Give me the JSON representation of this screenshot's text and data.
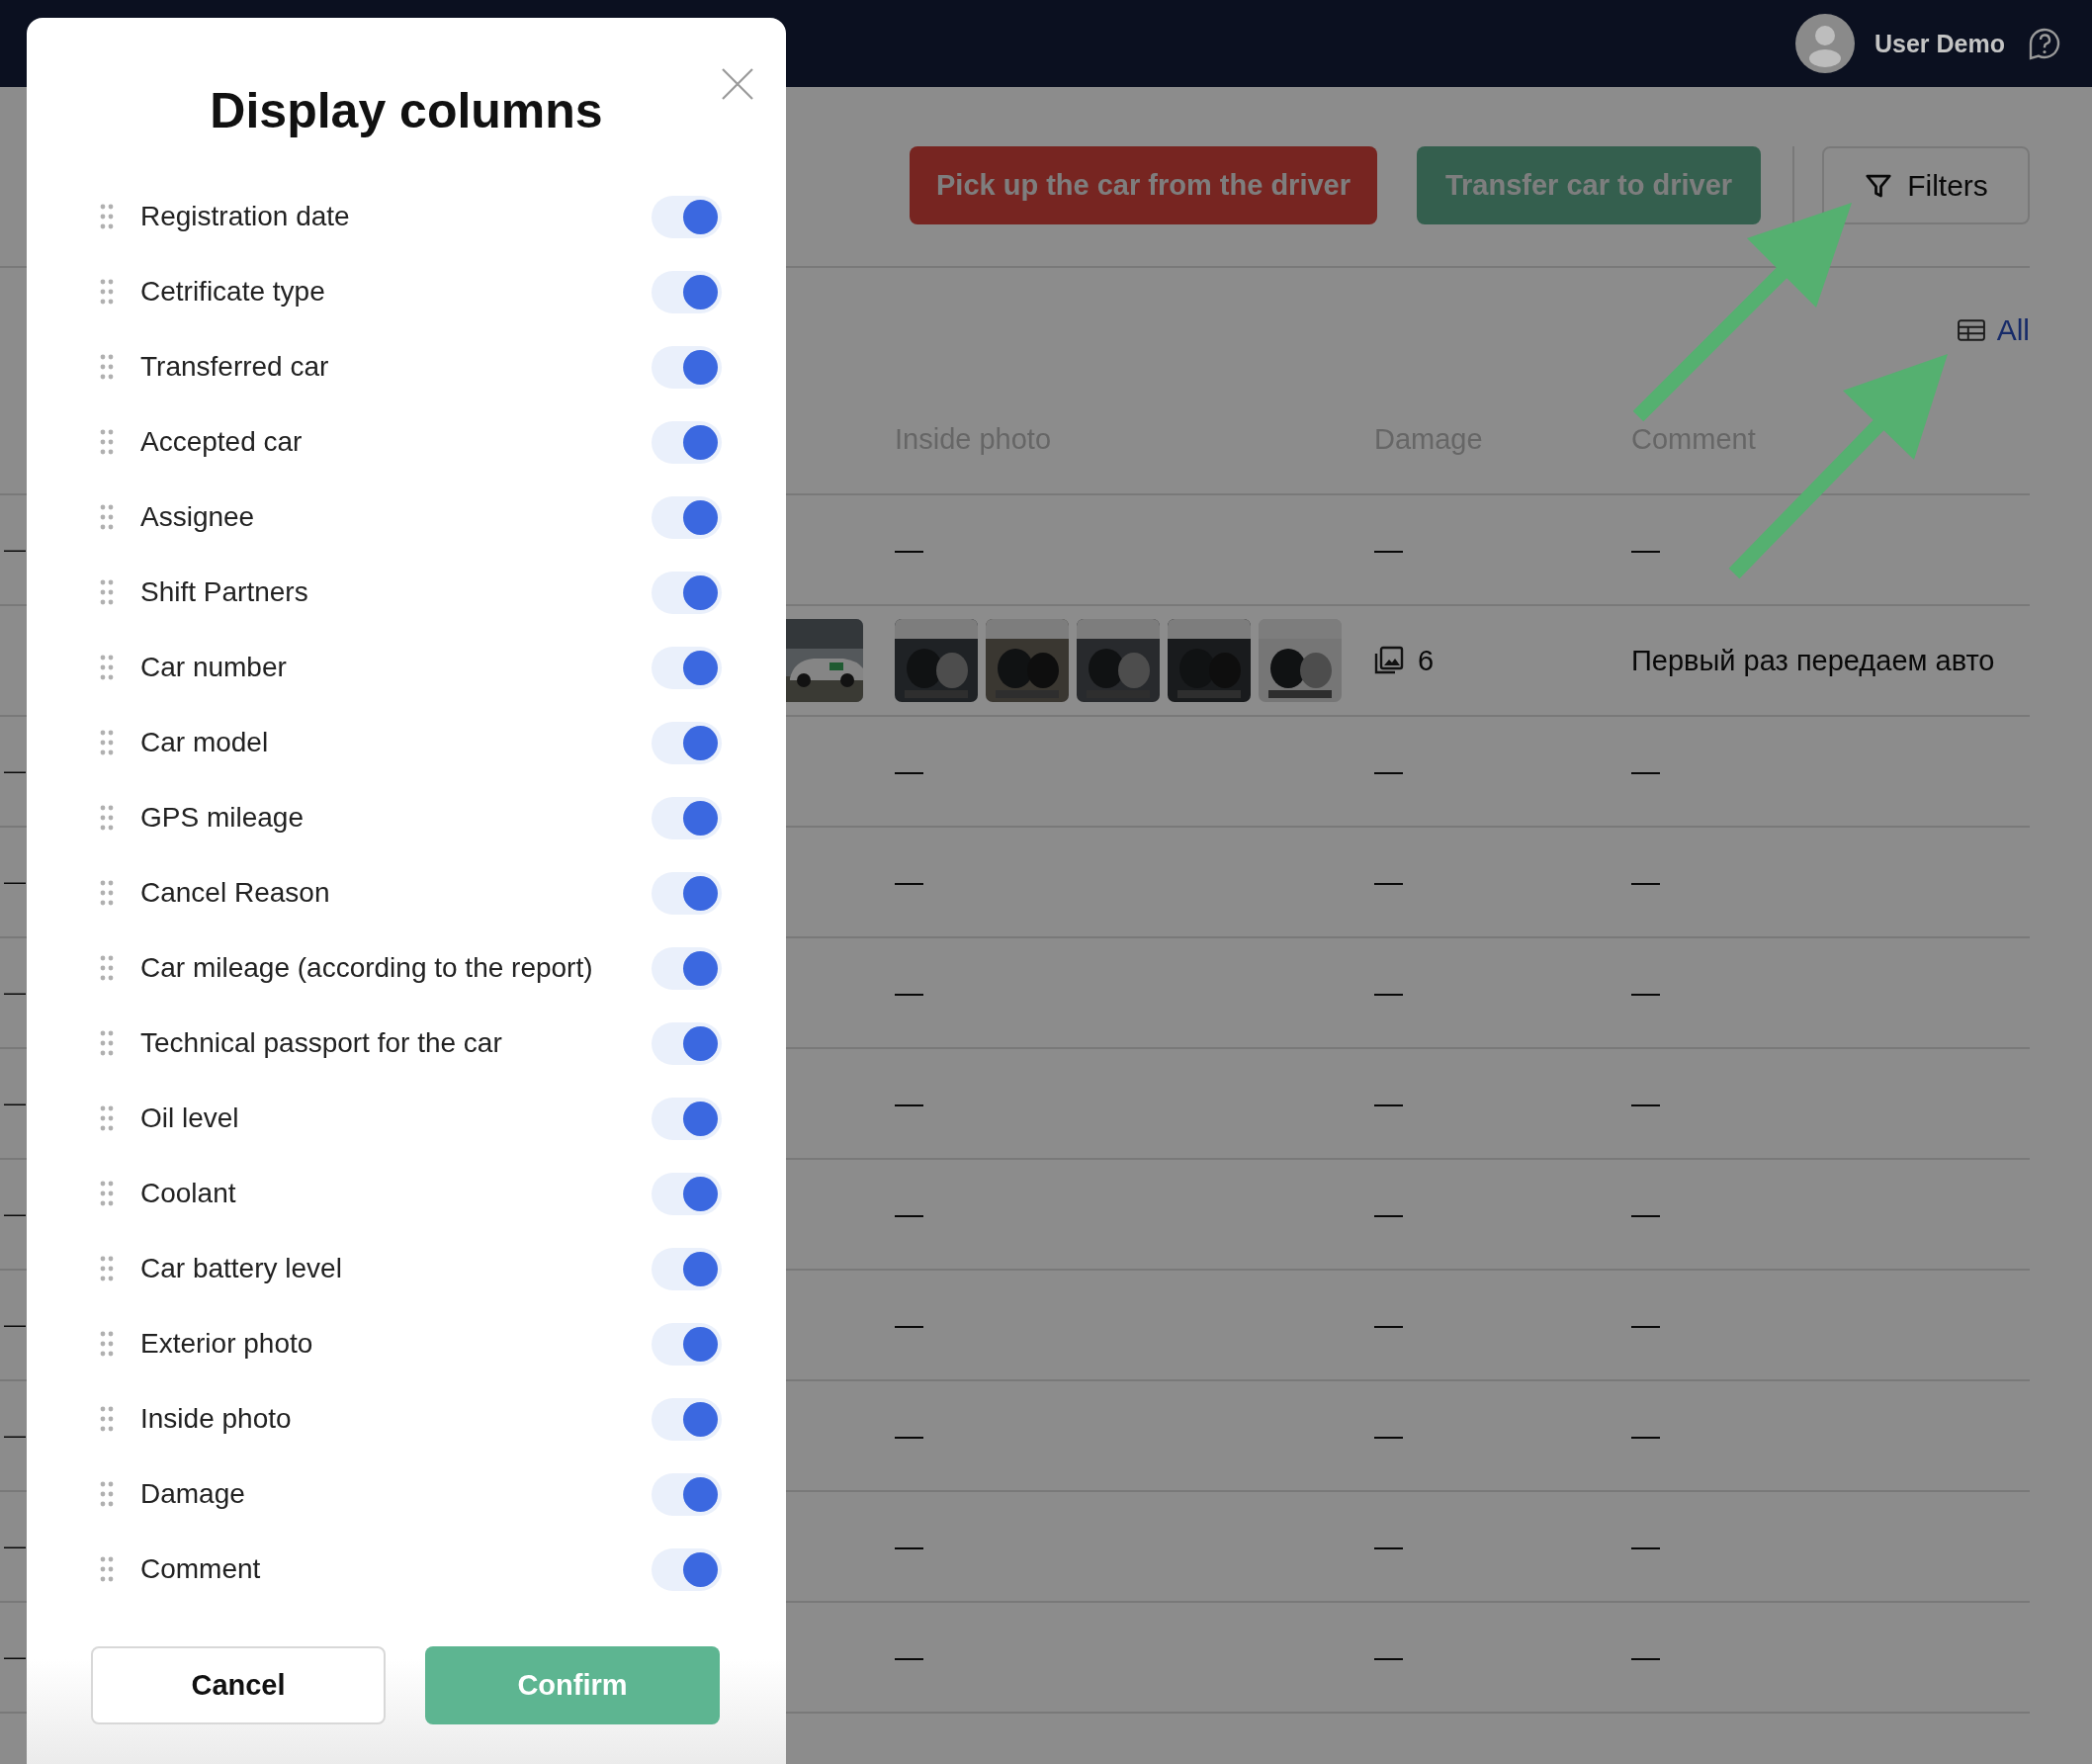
{
  "header": {
    "user_name": "User Demo"
  },
  "toolbar": {
    "buttons": [
      {
        "label": "Pick up the car from the driver",
        "kind": "danger"
      },
      {
        "label": "Transfer car to driver",
        "kind": "success"
      }
    ],
    "filters_button": "Filters",
    "columns_link": "All"
  },
  "table": {
    "columns": [
      "Inside photo",
      "Damage",
      "Comment"
    ],
    "rows": [
      {
        "kind": "empty",
        "lead": "—",
        "inside_photo": "—",
        "damage": "—",
        "comment": "—"
      },
      {
        "kind": "photos",
        "damage": "6",
        "comment": "Первый раз передаем авто"
      },
      {
        "kind": "empty",
        "lead": "—",
        "inside_photo": "—",
        "damage": "—",
        "comment": "—"
      },
      {
        "kind": "empty",
        "lead": "—",
        "inside_photo": "—",
        "damage": "—",
        "comment": "—"
      },
      {
        "kind": "empty",
        "lead": "—",
        "inside_photo": "—",
        "damage": "—",
        "comment": "—"
      },
      {
        "kind": "empty",
        "lead": "—",
        "inside_photo": "—",
        "damage": "—",
        "comment": "—"
      },
      {
        "kind": "empty",
        "lead": "—",
        "inside_photo": "—",
        "damage": "—",
        "comment": "—"
      },
      {
        "kind": "empty",
        "lead": "—",
        "inside_photo": "—",
        "damage": "—",
        "comment": "—"
      },
      {
        "kind": "empty",
        "lead": "—",
        "inside_photo": "—",
        "damage": "—",
        "comment": "—"
      },
      {
        "kind": "empty",
        "lead": "—",
        "inside_photo": "—",
        "damage": "—",
        "comment": "—"
      },
      {
        "kind": "empty",
        "lead": "—",
        "inside_photo": "—",
        "damage": "—",
        "comment": "—"
      }
    ]
  },
  "modal": {
    "title": "Display columns",
    "columns": [
      {
        "label": "Registration date",
        "on": true
      },
      {
        "label": "Cetrificate type",
        "on": true
      },
      {
        "label": "Transferred car",
        "on": true
      },
      {
        "label": "Accepted car",
        "on": true
      },
      {
        "label": "Assignee",
        "on": true
      },
      {
        "label": "Shift Partners",
        "on": true
      },
      {
        "label": "Car number",
        "on": true
      },
      {
        "label": "Car model",
        "on": true
      },
      {
        "label": "GPS mileage",
        "on": true
      },
      {
        "label": "Cancel Reason",
        "on": true
      },
      {
        "label": "Car mileage (according to the report)",
        "on": true
      },
      {
        "label": "Technical passport for the car",
        "on": true
      },
      {
        "label": "Oil level",
        "on": true
      },
      {
        "label": "Coolant",
        "on": true
      },
      {
        "label": "Car battery level",
        "on": true
      },
      {
        "label": "Exterior photo",
        "on": true
      },
      {
        "label": "Inside photo",
        "on": true
      },
      {
        "label": "Damage",
        "on": true
      },
      {
        "label": "Comment",
        "on": true
      }
    ],
    "cancel": "Cancel",
    "confirm": "Confirm"
  }
}
